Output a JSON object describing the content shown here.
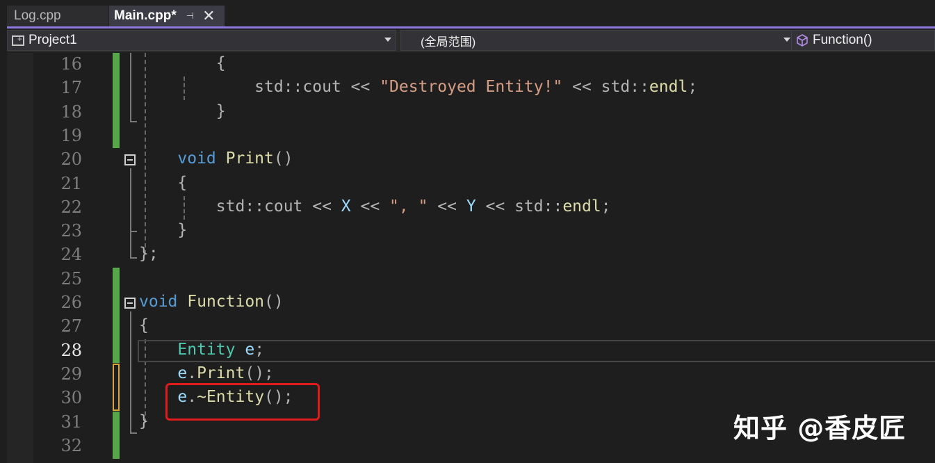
{
  "tabs": [
    {
      "label": "Log.cpp",
      "active": false
    },
    {
      "label": "Main.cpp*",
      "active": true
    }
  ],
  "tab_icons": {
    "pin": "pin-icon",
    "close": "close-icon"
  },
  "navbar": {
    "project": "Project1",
    "scope": "(全局范围)",
    "function": "Function()"
  },
  "lines": [
    {
      "number": "16",
      "tokens": [
        [
          "op",
          "        {"
        ]
      ]
    },
    {
      "number": "17",
      "tokens": [
        [
          "op",
          "            std::cout << "
        ],
        [
          "str",
          "\"Destroyed Entity!\""
        ],
        [
          "op",
          " << std::"
        ],
        [
          "fn",
          "endl"
        ],
        [
          "op",
          ";"
        ]
      ]
    },
    {
      "number": "18",
      "tokens": [
        [
          "op",
          "        }"
        ]
      ]
    },
    {
      "number": "19",
      "tokens": []
    },
    {
      "number": "20",
      "tokens": [
        [
          "kw",
          "    void "
        ],
        [
          "fn",
          "Print"
        ],
        [
          "op",
          "()"
        ]
      ]
    },
    {
      "number": "21",
      "tokens": [
        [
          "op",
          "    {"
        ]
      ]
    },
    {
      "number": "22",
      "tokens": [
        [
          "op",
          "        std::cout << "
        ],
        [
          "var",
          "X"
        ],
        [
          "op",
          " << "
        ],
        [
          "str",
          "\", \""
        ],
        [
          "op",
          " << "
        ],
        [
          "var",
          "Y"
        ],
        [
          "op",
          " << std::"
        ],
        [
          "fn",
          "endl"
        ],
        [
          "op",
          ";"
        ]
      ]
    },
    {
      "number": "23",
      "tokens": [
        [
          "op",
          "    }"
        ]
      ]
    },
    {
      "number": "24",
      "tokens": [
        [
          "op",
          "};"
        ]
      ]
    },
    {
      "number": "25",
      "tokens": []
    },
    {
      "number": "26",
      "tokens": [
        [
          "kw",
          "void "
        ],
        [
          "fn",
          "Function"
        ],
        [
          "op",
          "()"
        ]
      ]
    },
    {
      "number": "27",
      "tokens": [
        [
          "op",
          "{"
        ]
      ]
    },
    {
      "number": "28",
      "tokens": [
        [
          "type",
          "    Entity "
        ],
        [
          "var",
          "e"
        ],
        [
          "op",
          ";"
        ]
      ]
    },
    {
      "number": "29",
      "tokens": [
        [
          "var",
          "    e"
        ],
        [
          "op",
          "."
        ],
        [
          "fn",
          "Print"
        ],
        [
          "op",
          "();"
        ]
      ]
    },
    {
      "number": "30",
      "tokens": [
        [
          "var",
          "    e"
        ],
        [
          "op",
          "."
        ],
        [
          "fn",
          "~Entity"
        ],
        [
          "op",
          "();"
        ]
      ]
    },
    {
      "number": "31",
      "tokens": [
        [
          "op",
          "}"
        ]
      ]
    },
    {
      "number": "32",
      "tokens": []
    }
  ],
  "current_line": "28",
  "colors": {
    "keyword": "#569cd6",
    "function": "#dcdcaa",
    "string": "#d69d85",
    "type": "#4ec9b0",
    "variable": "#9cdcfe",
    "saved_change": "#57a64a",
    "unsaved_change": "#d7a63a",
    "highlight": "#e01b1b",
    "accent": "#8f78e0"
  },
  "watermark": "知乎 @香皮匠"
}
